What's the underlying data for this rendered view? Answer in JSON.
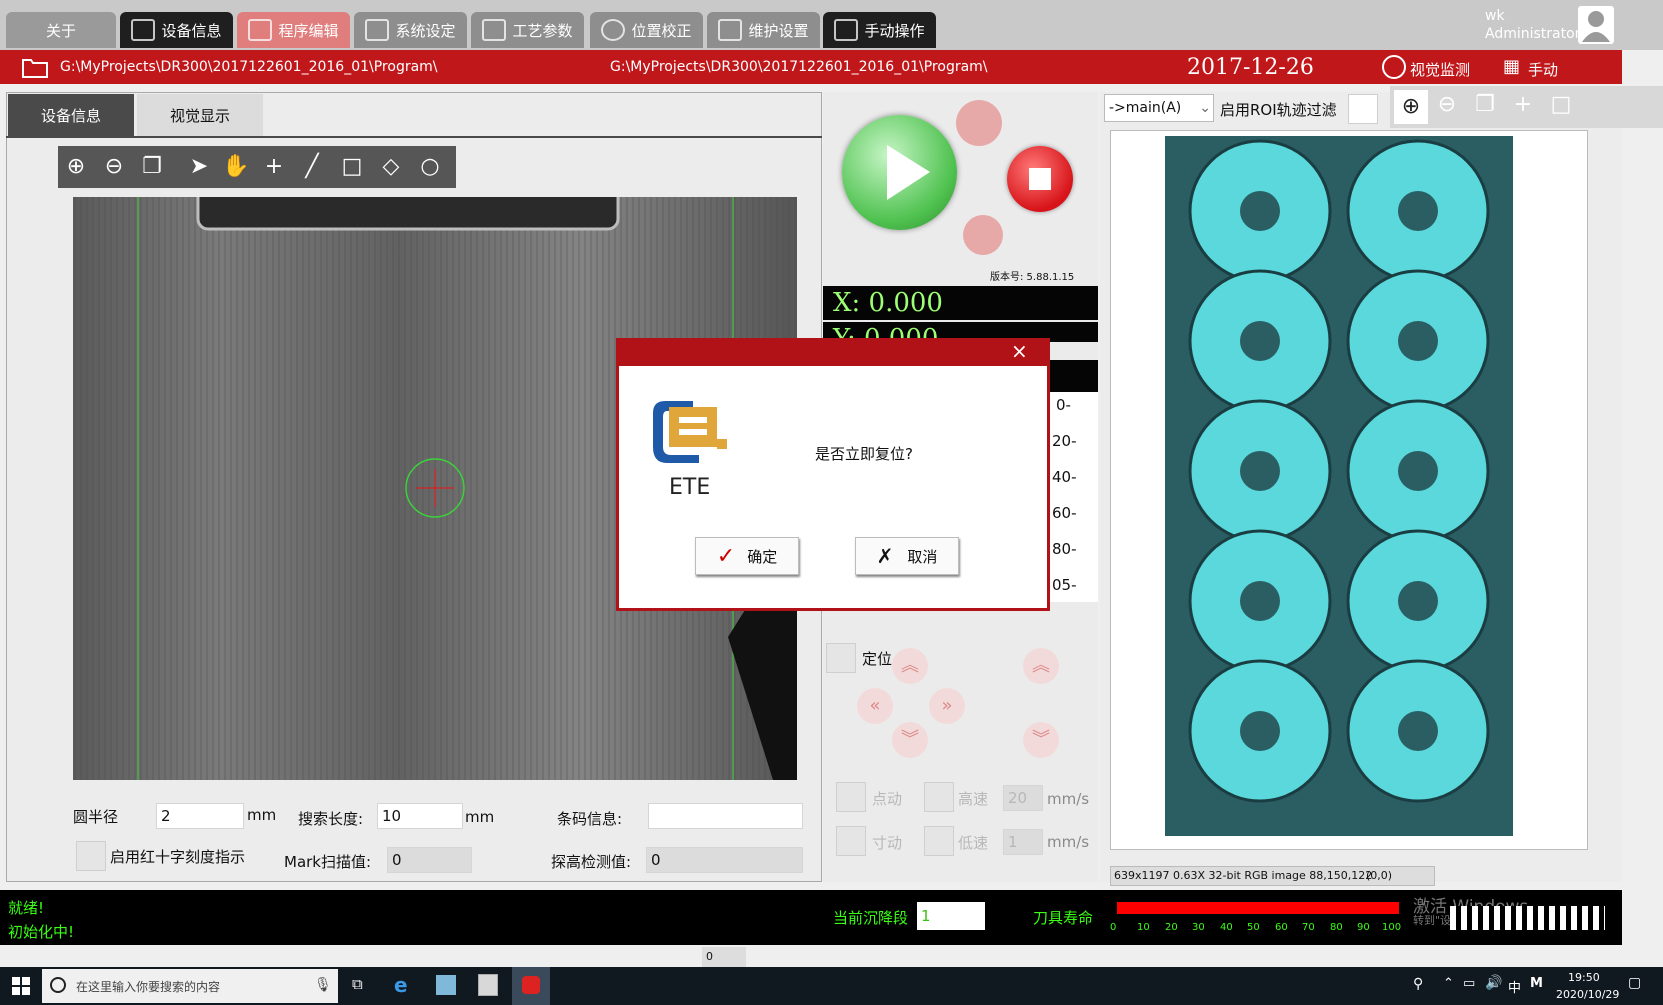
{
  "top_tabs": [
    {
      "label": "关于"
    },
    {
      "label": "设备信息"
    },
    {
      "label": "程序编辑"
    },
    {
      "label": "系统设定"
    },
    {
      "label": "工艺参数"
    },
    {
      "label": "位置校正"
    },
    {
      "label": "维护设置"
    },
    {
      "label": "手动操作"
    }
  ],
  "user": {
    "name": "wk",
    "role": "Administrator"
  },
  "pathbar": {
    "path_left": "G:\\MyProjects\\DR300\\2017122601_2016_01\\Program\\",
    "path_center": "G:\\MyProjects\\DR300\\2017122601_2016_01\\Program\\",
    "date": "2017-12-26",
    "vision_label": "视觉监测",
    "manual_label": "手动"
  },
  "left_tabs": [
    {
      "label": "设备信息"
    },
    {
      "label": "视觉显示"
    }
  ],
  "vision_params": {
    "radius_label": "圆半径",
    "radius_value": "2",
    "radius_unit": "mm",
    "search_label": "搜索长度:",
    "search_value": "10",
    "search_unit": "mm",
    "barcode_label": "条码信息:",
    "barcode_value": "",
    "crosshair_label": "启用红十字刻度指示",
    "mark_label": "Mark扫描值:",
    "mark_value": "0",
    "height_label": "探高检测值:",
    "height_value": "0"
  },
  "machine": {
    "version": "版本号: 5.88.1.15",
    "x_coord": "X: 0.000",
    "y_coord": "Y: 0.000",
    "scale_labels": [
      "0-",
      "20-",
      "40-",
      "60-",
      "80-",
      "05-"
    ],
    "locate_label": "定位",
    "jog_label": "点动",
    "high_speed_label": "高速",
    "speed_value": "20",
    "speed_unit": "mm/s",
    "inch_label": "寸动",
    "low_speed_label": "低速",
    "low_speed_value": "1",
    "low_speed_unit": "mm/s"
  },
  "right_panel": {
    "program_select": "->main(A)",
    "roi_label": "启用ROI轨迹过滤",
    "image_info": "639x1197 0.63X 32-bit RGB image 88,150,122",
    "image_coord": "(0,0)"
  },
  "status": {
    "line1": "就绪!",
    "line2": "初始化中!",
    "segment_label": "当前沉降段",
    "segment_value": "1",
    "tool_life_label": "刀具寿命",
    "tool_life_ticks": [
      "0",
      "10",
      "20",
      "30",
      "40",
      "50",
      "60",
      "70",
      "80",
      "90",
      "100"
    ],
    "tool_life_fraction": 1.0,
    "bottom_value": "0",
    "watermark_line1": "激活 Windows",
    "watermark_line2": "转到\"设置\"以激活 Windows。"
  },
  "dialog": {
    "logo_text": "ETE",
    "message": "是否立即复位?",
    "ok_label": "确定",
    "cancel_label": "取消",
    "close_glyph": "×"
  },
  "taskbar": {
    "search_placeholder": "在这里输入你要搜索的内容",
    "time": "19:50",
    "date": "2020/10/29",
    "ime": "中"
  },
  "colors": {
    "brand_red": "#c0171b",
    "coord_green": "#9cff74",
    "status_green": "#39ff14"
  }
}
